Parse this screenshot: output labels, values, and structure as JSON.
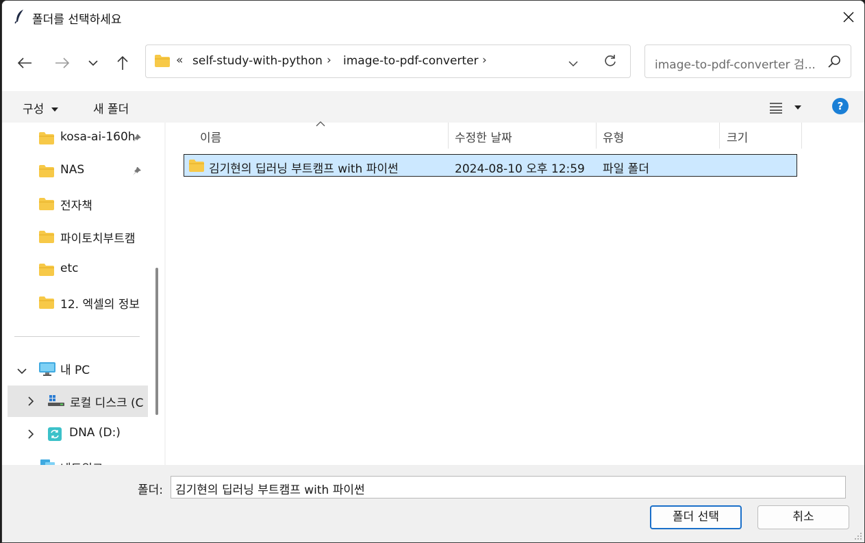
{
  "window": {
    "title": "폴더를 선택하세요",
    "title_icon": "feather-icon"
  },
  "nav": {
    "back_icon": "arrow-left-icon",
    "forward_icon": "arrow-right-icon",
    "recent_icon": "chevron-down-icon",
    "up_icon": "arrow-up-icon"
  },
  "address": {
    "overflow": "«",
    "crumbs": [
      "self-study-with-python",
      "image-to-pdf-converter"
    ],
    "separator": "›"
  },
  "search": {
    "placeholder": "image-to-pdf-converter 검..."
  },
  "command_bar": {
    "organize": "구성",
    "new_folder": "새 폴더",
    "help": "?"
  },
  "sidebar": {
    "quick_access": [
      {
        "label": "kosa-ai-160h",
        "pinned": true
      },
      {
        "label": "NAS",
        "pinned": true
      },
      {
        "label": "전자책",
        "pinned": false
      },
      {
        "label": "파이토치부트캠",
        "pinned": false
      },
      {
        "label": "etc",
        "pinned": false
      },
      {
        "label": "12. 엑셀의 정보",
        "pinned": false
      }
    ],
    "this_pc": "내 PC",
    "drives": [
      {
        "label": "로컬 디스크 (C",
        "selected": true
      },
      {
        "label": "DNA (D:)",
        "selected": false
      }
    ],
    "network": "네트워크"
  },
  "columns": {
    "name": "이름",
    "modified": "수정한 날짜",
    "type": "유형",
    "size": "크기"
  },
  "files": [
    {
      "name": "김기현의 딥러닝 부트캠프 with 파이썬",
      "modified": "2024-08-10 오후 12:59",
      "type": "파일 폴더",
      "size": ""
    }
  ],
  "footer": {
    "folder_label": "폴더:",
    "folder_value": "김기현의 딥러닝 부트캠프 with 파이썬",
    "select_button": "폴더 선택",
    "cancel_button": "취소"
  },
  "colors": {
    "selection": "#cce8ff",
    "folder": "#f7c948",
    "accent": "#1a6fc9",
    "help": "#1a7fd6"
  }
}
